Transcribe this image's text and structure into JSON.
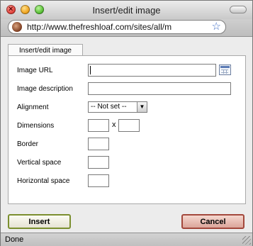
{
  "window": {
    "title": "Insert/edit image"
  },
  "address_bar": {
    "url": "http://www.thefreshloaf.com/sites/all/m"
  },
  "tabs": [
    {
      "label": "Insert/edit image",
      "active": true
    }
  ],
  "form": {
    "image_url": {
      "label": "Image URL",
      "value": ""
    },
    "image_description": {
      "label": "Image description",
      "value": ""
    },
    "alignment": {
      "label": "Alignment",
      "selected": "-- Not set --"
    },
    "dimensions": {
      "label": "Dimensions",
      "width": "",
      "height": "",
      "separator": "x"
    },
    "border": {
      "label": "Border",
      "value": ""
    },
    "vertical_space": {
      "label": "Vertical space",
      "value": ""
    },
    "horizontal_space": {
      "label": "Horizontal space",
      "value": ""
    }
  },
  "buttons": {
    "insert": "Insert",
    "cancel": "Cancel"
  },
  "status_bar": {
    "text": "Done"
  },
  "icons": {
    "close": "close-icon",
    "minimize": "minimize-icon",
    "zoom": "zoom-icon",
    "favicon": "site-favicon-icon",
    "bookmark": "star-icon",
    "browse": "browse-icon"
  },
  "colors": {
    "insert_border": "#7b8f2f",
    "cancel_border": "#a3483c",
    "bookmark_star": "#3e6cc4"
  }
}
